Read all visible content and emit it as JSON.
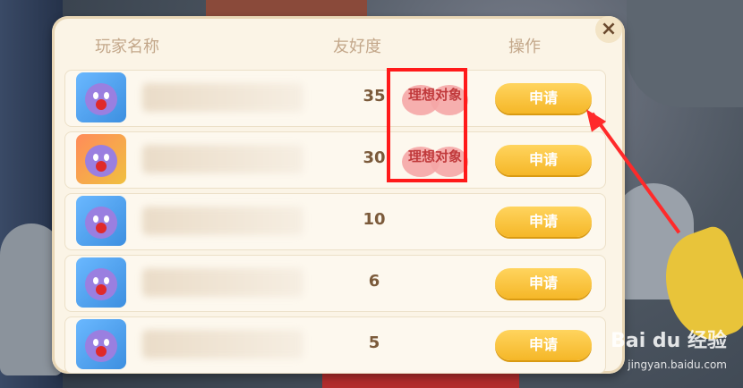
{
  "headers": {
    "name": "玩家名称",
    "friendship": "友好度",
    "action": "操作"
  },
  "close_icon": "×",
  "rows": [
    {
      "name_visible": "",
      "score": "35",
      "tag": "理想对象",
      "button": "申请",
      "avatar": "alt-blue"
    },
    {
      "name_visible": "",
      "score": "30",
      "tag": "理想对象",
      "button": "申请",
      "avatar": "alt-orange"
    },
    {
      "name_visible": "",
      "score": "10",
      "tag": "",
      "button": "申请",
      "avatar": "alt-blue"
    },
    {
      "name_visible": "",
      "score": "6",
      "tag": "",
      "button": "申请",
      "avatar": "alt-blue"
    },
    {
      "name_visible": "",
      "score": "5",
      "tag": "",
      "button": "申请",
      "avatar": "alt-blue"
    }
  ],
  "watermark": {
    "brand": "Bai du 经验",
    "url": "jingyan.baidu.com"
  },
  "colors": {
    "accent": "#f5b728",
    "highlight": "#ff1a1a",
    "panel": "#fbf4e6"
  }
}
